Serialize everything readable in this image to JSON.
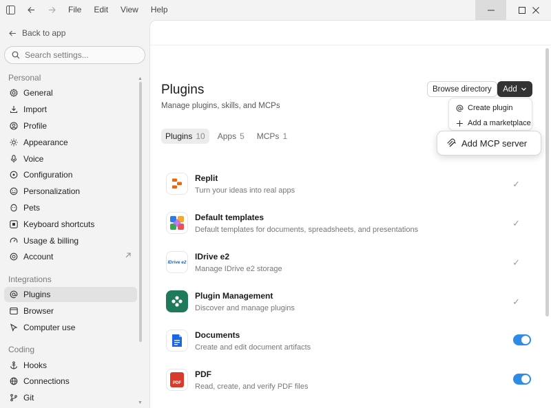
{
  "titlebar": {
    "menus": [
      "File",
      "Edit",
      "View",
      "Help"
    ]
  },
  "sidebar": {
    "back_label": "Back to app",
    "search_placeholder": "Search settings...",
    "sections": {
      "personal": "Personal",
      "integrations": "Integrations",
      "coding": "Coding"
    },
    "personal_items": [
      "General",
      "Import",
      "Profile",
      "Appearance",
      "Voice",
      "Configuration",
      "Personalization",
      "Pets",
      "Keyboard shortcuts",
      "Usage & billing",
      "Account"
    ],
    "integration_items": [
      "Plugins",
      "Browser",
      "Computer use"
    ],
    "coding_items": [
      "Hooks",
      "Connections",
      "Git"
    ],
    "active_item": "Plugins"
  },
  "main": {
    "title": "Plugins",
    "subtitle": "Manage plugins, skills, and MCPs",
    "browse_label": "Browse directory",
    "add_label": "Add",
    "tabs": [
      {
        "label": "Plugins",
        "count": "10"
      },
      {
        "label": "Apps",
        "count": "5"
      },
      {
        "label": "MCPs",
        "count": "1"
      }
    ],
    "dropdown": {
      "create_plugin": "Create plugin",
      "add_marketplace": "Add a marketplace",
      "add_mcp_server": "Add MCP server"
    },
    "plugins": [
      {
        "name": "Replit",
        "desc": "Turn your ideas into real apps",
        "state": "installed"
      },
      {
        "name": "Default templates",
        "desc": "Default templates for documents, spreadsheets, and presentations",
        "state": "installed"
      },
      {
        "name": "IDrive e2",
        "desc": "Manage IDrive e2 storage",
        "state": "installed"
      },
      {
        "name": "Plugin Management",
        "desc": "Discover and manage plugins",
        "state": "installed"
      },
      {
        "name": "Documents",
        "desc": "Create and edit document artifacts",
        "state": "enabled"
      },
      {
        "name": "PDF",
        "desc": "Read, create, and verify PDF files",
        "state": "enabled"
      }
    ],
    "idrive_logo_text": "IDrive e2",
    "pdf_logo_text": "PDF"
  },
  "colors": {
    "accent_toggle": "#2f8be6",
    "add_button": "#333333",
    "replit": "#f26207",
    "plugin_mgmt": "#1e7a5a",
    "documents": "#1a66e6",
    "pdf": "#d83b2b"
  }
}
